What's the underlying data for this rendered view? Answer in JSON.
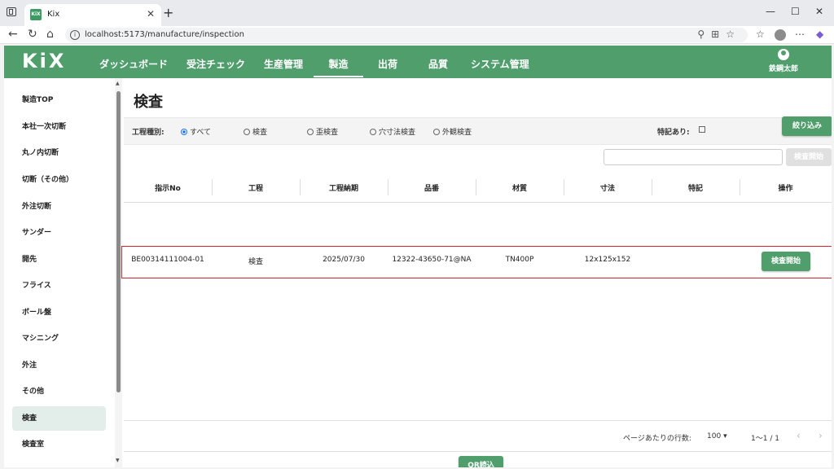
{
  "browser": {
    "tab_title": "Kix",
    "tab_favicon": "KiX",
    "url": "localhost:5173/manufacture/inspection"
  },
  "app": {
    "logo": "KiX",
    "nav": [
      "ダッシュボード",
      "受注チェック",
      "生産管理",
      "製造",
      "出荷",
      "品質",
      "システム管理"
    ],
    "active_nav": "製造",
    "user_name": "鉄鋼太郎",
    "accent_color": "#4f9e6c"
  },
  "sidebar": {
    "items": [
      "製造TOP",
      "本社一次切断",
      "丸ノ内切断",
      "切断（その他）",
      "外注切断",
      "サンダー",
      "開先",
      "フライス",
      "ボール盤",
      "マシニング",
      "外注",
      "その他",
      "検査",
      "検査室"
    ],
    "active": "検査"
  },
  "page": {
    "title": "検査",
    "filter_label": "工程種別:",
    "radios": [
      "すべて",
      "検査",
      "歪検査",
      "穴寸法検査",
      "外観検査"
    ],
    "selected_radio": "すべて",
    "special_label": "特記あり:",
    "filter_button": "絞り込み",
    "search_value": "",
    "start_button_disabled": "検査開始"
  },
  "table": {
    "headers": [
      "指示No",
      "工程",
      "工程納期",
      "品番",
      "材質",
      "寸法",
      "特記",
      "操作"
    ],
    "rows": [
      {
        "no": "BE00314111004-01",
        "process": "検査",
        "due": "2025/07/30",
        "part": "12322-43650-71@NA",
        "material": "TN400P",
        "size": "12x125x152",
        "note": "",
        "action": "検査開始"
      }
    ]
  },
  "pager": {
    "rows_label": "ページあたりの行数:",
    "rows_per_page": "100",
    "range": "1〜1 / 1"
  },
  "qr_button": "QR読込"
}
